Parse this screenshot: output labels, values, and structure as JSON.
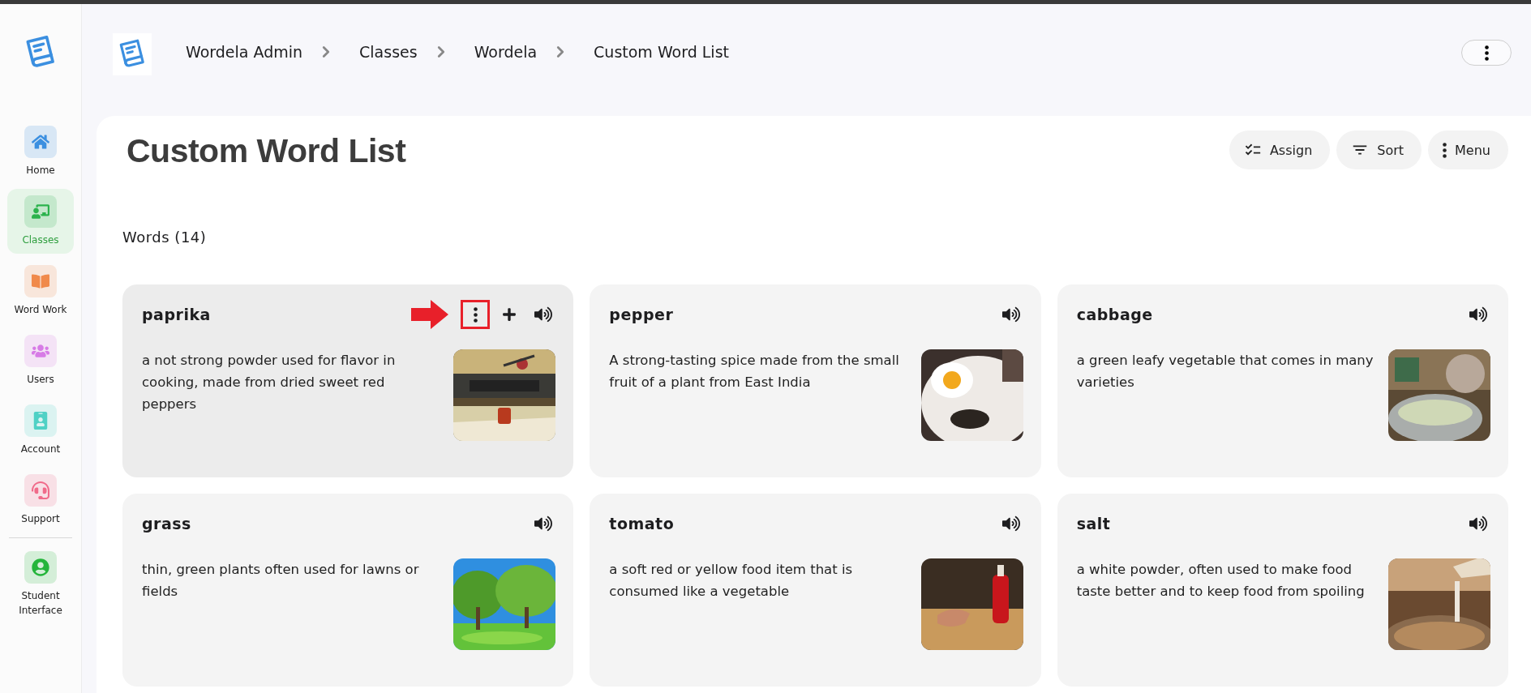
{
  "sidebar": {
    "items": [
      {
        "label": "Home",
        "kind": "home",
        "color": "#3b8fe0",
        "selected": false
      },
      {
        "label": "Classes",
        "kind": "classes",
        "color": "#2bb24c",
        "selected": true
      },
      {
        "label": "Word Work",
        "kind": "book",
        "color": "#f08a4b",
        "selected": false
      },
      {
        "label": "Users",
        "kind": "users",
        "color": "#d77be6",
        "selected": false
      },
      {
        "label": "Account",
        "kind": "account",
        "color": "#4fd1c5",
        "selected": false
      },
      {
        "label": "Support",
        "kind": "support",
        "color": "#f06b8a",
        "selected": false
      },
      {
        "label": "Student Interface",
        "kind": "student",
        "color": "#25b53b",
        "selected": false,
        "divider": true
      }
    ]
  },
  "header": {
    "breadcrumbs": [
      "Wordela Admin",
      "Classes",
      "Wordela",
      "Custom Word List"
    ]
  },
  "page": {
    "title": "Custom Word List",
    "actions": [
      {
        "label": "Assign",
        "kind": "assign"
      },
      {
        "label": "Sort",
        "kind": "sort"
      },
      {
        "label": "Menu",
        "kind": "menu"
      }
    ],
    "section_title": "Words (14)"
  },
  "words": [
    {
      "word": "paprika",
      "definition": "a not strong powder used for flavor in cooking, made from dried sweet red peppers",
      "hovered": true,
      "annotated": true
    },
    {
      "word": "pepper",
      "definition": "A strong-tasting spice made from the small fruit of a plant from East India",
      "hovered": false,
      "annotated": false
    },
    {
      "word": "cabbage",
      "definition": "a green leafy vegetable that comes in many varieties",
      "hovered": false,
      "annotated": false
    },
    {
      "word": "grass",
      "definition": "thin, green plants often used for lawns or fields",
      "hovered": false,
      "annotated": false
    },
    {
      "word": "tomato",
      "definition": "a soft red or yellow food item that is consumed like a vegetable",
      "hovered": false,
      "annotated": false
    },
    {
      "word": "salt",
      "definition": "a white powder, often used to make food taste better and to keep food from spoiling",
      "hovered": false,
      "annotated": false
    }
  ]
}
